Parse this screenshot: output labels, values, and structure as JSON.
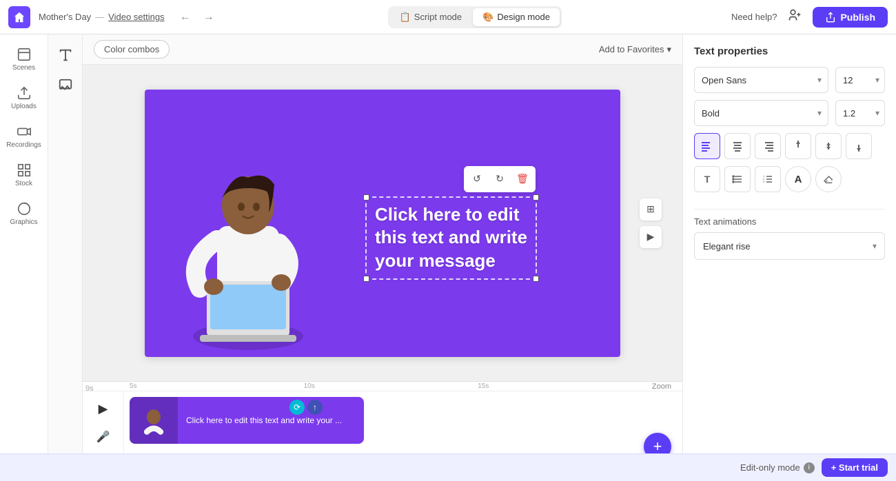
{
  "topbar": {
    "home_icon": "🏠",
    "project_name": "Mother's Day",
    "separator": "—",
    "video_settings": "Video settings",
    "back_icon": "←",
    "forward_icon": "→",
    "script_mode_label": "Script mode",
    "design_mode_label": "Design mode",
    "need_help": "Need help?",
    "add_user_icon": "👤",
    "publish_label": "Publish"
  },
  "sidebar": {
    "items": [
      {
        "id": "scenes",
        "label": "Scenes"
      },
      {
        "id": "uploads",
        "label": "Uploads"
      },
      {
        "id": "recordings",
        "label": "Recordings"
      },
      {
        "id": "stock",
        "label": "Stock"
      },
      {
        "id": "graphics",
        "label": "Graphics"
      }
    ]
  },
  "canvas_toolbar": {
    "color_combos": "Color combos",
    "add_to_favorites": "Add to Favorites",
    "chevron": "▾"
  },
  "canvas": {
    "text_line1": "Click here to edit",
    "text_line2": "this text and write",
    "text_line3": "your message"
  },
  "timeline": {
    "time_markers": [
      "5s",
      "10s",
      "15s"
    ],
    "zoom_label": "Zoom",
    "nine_s": "9s",
    "clip_text": "Click here to edit this text and write your ...",
    "add_scene_label": "Add scene"
  },
  "right_panel": {
    "title": "Text properties",
    "font_family": "Open Sans",
    "font_size": "12",
    "font_weight": "Bold",
    "line_height": "1.2",
    "align_options": [
      {
        "id": "align-left",
        "icon": "≡",
        "label": "Align left",
        "active": true
      },
      {
        "id": "align-center",
        "icon": "≡",
        "label": "Align center",
        "active": false
      },
      {
        "id": "align-right",
        "icon": "≡",
        "label": "Align right",
        "active": false
      },
      {
        "id": "align-top",
        "icon": "↑",
        "label": "Align top",
        "active": false
      },
      {
        "id": "align-middle",
        "icon": "↕",
        "label": "Align middle",
        "active": false
      },
      {
        "id": "align-bottom",
        "icon": "↓",
        "label": "Align bottom",
        "active": false
      }
    ],
    "format_btns": [
      {
        "id": "bold-T",
        "icon": "T",
        "label": "Bold text format"
      },
      {
        "id": "list",
        "icon": "≡",
        "label": "List"
      },
      {
        "id": "ordered-list",
        "icon": "1≡",
        "label": "Ordered list"
      },
      {
        "id": "text-color",
        "icon": "A",
        "label": "Text color"
      },
      {
        "id": "eraser",
        "icon": "✏",
        "label": "Eraser"
      }
    ],
    "animation_title": "Text animations",
    "animation_value": "Elegant rise"
  },
  "bottom_bar": {
    "edit_only_label": "Edit-only mode",
    "start_trial_label": "+ Start trial"
  }
}
